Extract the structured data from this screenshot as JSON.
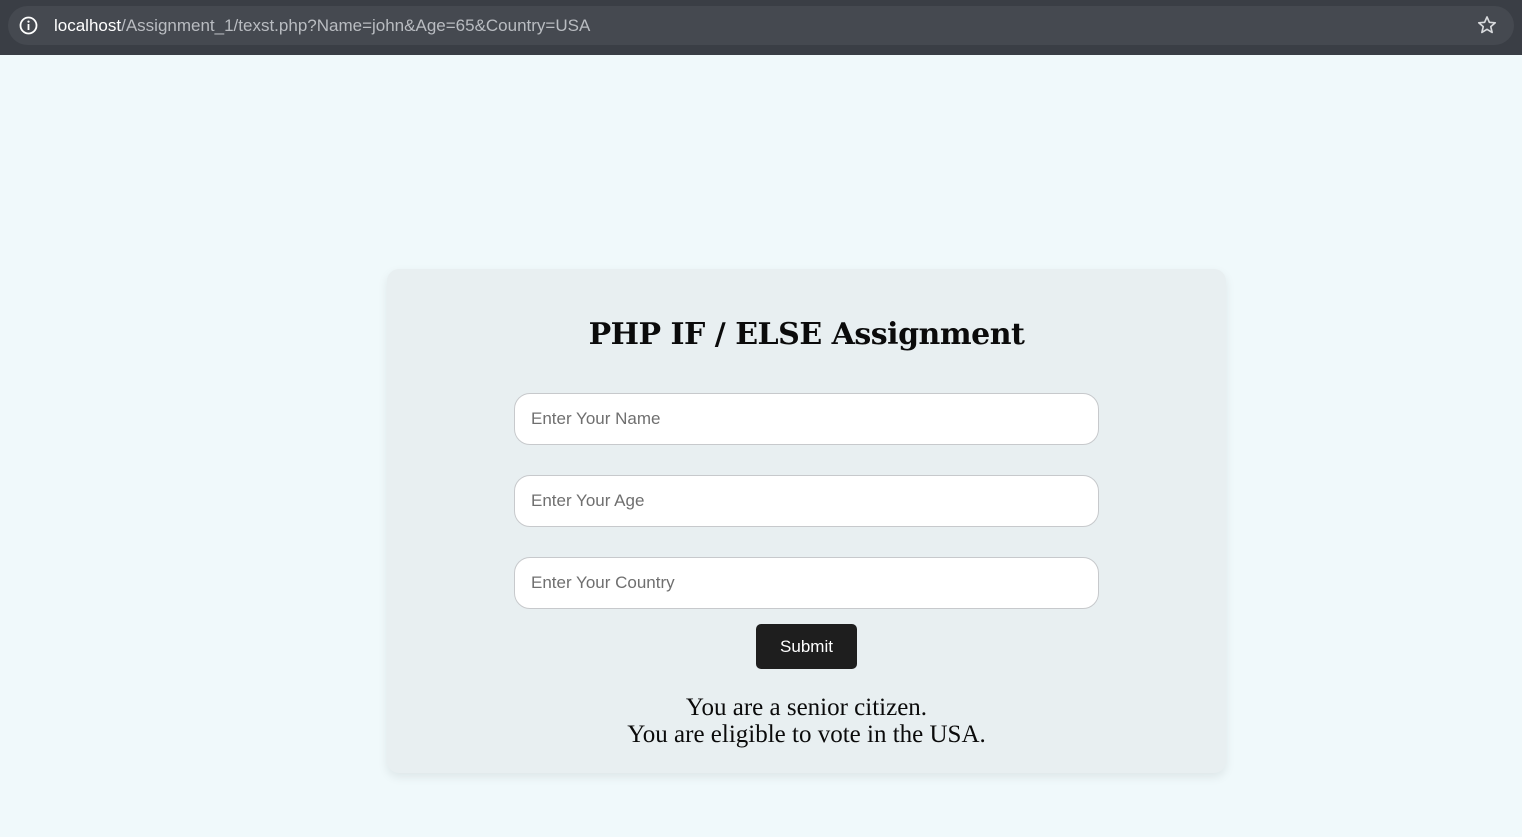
{
  "browser": {
    "url_host": "localhost",
    "url_path": "/Assignment_1/texst.php?Name=john&Age=65&Country=USA"
  },
  "form": {
    "title": "PHP IF / ELSE Assignment",
    "name_placeholder": "Enter Your Name",
    "name_value": "",
    "age_placeholder": "Enter Your Age",
    "age_value": "",
    "country_placeholder": "Enter Your Country",
    "country_value": "",
    "submit_label": "Submit"
  },
  "results": {
    "line1": "You are a senior citizen.",
    "line2": "You are eligible to vote in the USA."
  },
  "icons": {
    "info": "info-icon",
    "bookmark": "star-icon"
  },
  "colors": {
    "page_bg": "#f0f9fb",
    "card_bg": "#e8eff1",
    "button_bg": "#1e1e1e",
    "browser_bar": "#3a3e45"
  }
}
